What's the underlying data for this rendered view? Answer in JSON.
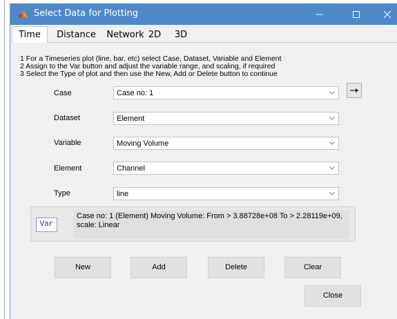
{
  "window": {
    "title": "Select Data for Plotting",
    "titlebar_color": "#4f88c9",
    "icon": "matlab-icon"
  },
  "tabs": [
    {
      "label": "Time",
      "active": true
    },
    {
      "label": "Distance",
      "active": false
    },
    {
      "label": "Network",
      "active": false
    },
    {
      "label": "2D",
      "active": false
    },
    {
      "label": "3D",
      "active": false
    }
  ],
  "instructions": [
    "1 For a Timeseries plot (line, bar, etc) select Case, Dataset, Variable and Element",
    "2 Assign to the Var button and adjust the variable range, and scaling, if required",
    "3 Select the Type of plot and then use the New, Add or Delete button to continue"
  ],
  "fields": {
    "case": {
      "label": "Case",
      "value": "Case no: 1"
    },
    "dataset": {
      "label": "Dataset",
      "value": "Element"
    },
    "variable": {
      "label": "Variable",
      "value": "Moving Volume"
    },
    "element": {
      "label": "Element",
      "value": "Channel"
    },
    "type": {
      "label": "Type",
      "value": "line"
    }
  },
  "var_panel": {
    "button_label": "Var",
    "description": "Case no: 1 (Element) Moving Volume: From > 3.88728e+08 To > 2.28119e+09, scale: Linear"
  },
  "buttons": {
    "new": "New",
    "add": "Add",
    "delete": "Delete",
    "clear": "Clear",
    "close": "Close"
  }
}
